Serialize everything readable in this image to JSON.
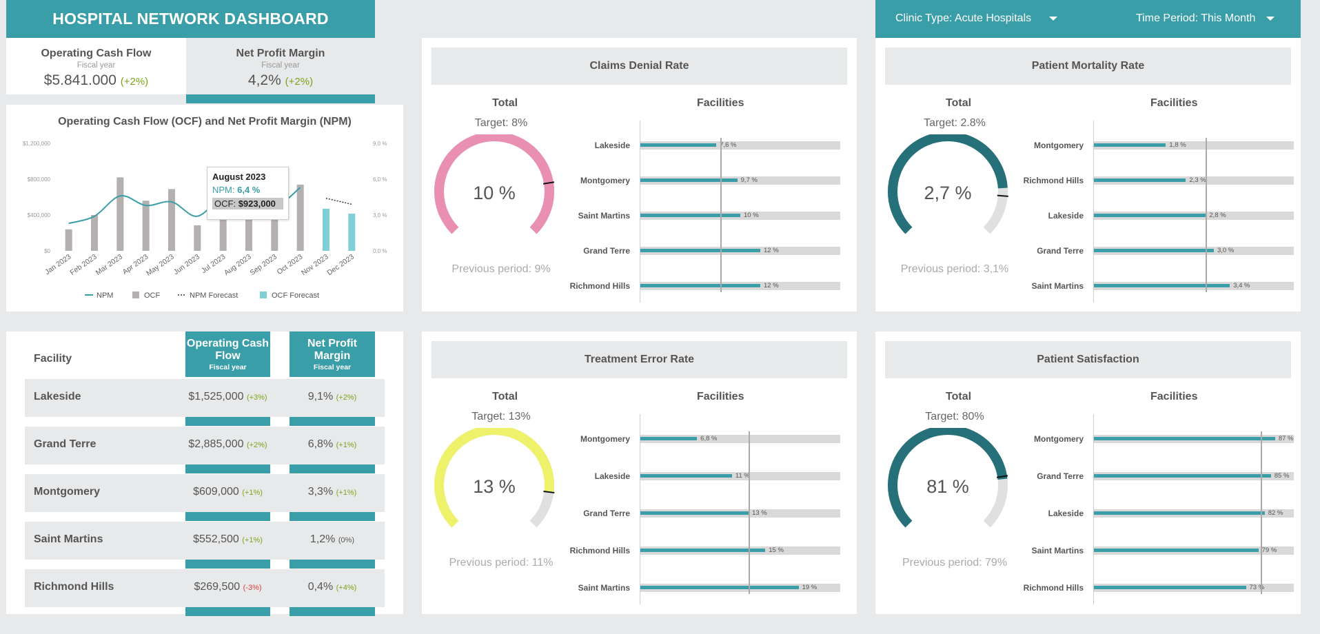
{
  "header": {
    "title": "HOSPITAL NETWORK DASHBOARD"
  },
  "filters": [
    {
      "label": "Clinic Type: Acute Hospitals"
    },
    {
      "label": "Time Period: This Month"
    }
  ],
  "kpis": [
    {
      "title": "Operating Cash Flow",
      "subtitle": "Fiscal year",
      "value": "$5.841.000",
      "change": "(+2%)"
    },
    {
      "title": "Net Profit Margin",
      "subtitle": "Fiscal year",
      "value": "4,2%",
      "change": "(+2%)"
    }
  ],
  "chart_panel": {
    "tooltip": {
      "title": "August 2023",
      "npm_label": "NPM:",
      "npm_value": "6,4 %",
      "ocf_label": "OCF:",
      "ocf_value": "$923,000"
    }
  },
  "chart_data": {
    "type": "bar",
    "title": "Operating Cash Flow (OCF) and Net Profit Margin (NPM)",
    "categories": [
      "Jan 2023",
      "Feb 2023",
      "Mar 2023",
      "Apr 2023",
      "May 2023",
      "Jun 2023",
      "Jul 2023",
      "Aug 2023",
      "Sep 2023",
      "Oct 2023",
      "Nov 2023",
      "Dec 2023"
    ],
    "y_left_ticks": [
      "$1,200,000",
      "$800,000",
      "$400,000",
      "$0"
    ],
    "y_right_ticks": [
      "9,0 %",
      "6,0 %",
      "3,0 %",
      "0,0 %"
    ],
    "ylim_left": [
      0,
      1200000
    ],
    "ylim_right": [
      0,
      9
    ],
    "series": [
      {
        "name": "OCF",
        "type": "bar",
        "color": "#b5b0b0",
        "values": [
          240000,
          400000,
          820000,
          560000,
          690000,
          285000,
          520000,
          923000,
          590000,
          740000,
          null,
          null
        ]
      },
      {
        "name": "OCF Forecast",
        "type": "bar",
        "color": "#7fcfd7",
        "values": [
          null,
          null,
          null,
          null,
          null,
          null,
          null,
          null,
          null,
          null,
          470000,
          415000
        ]
      },
      {
        "name": "NPM",
        "type": "line",
        "color": "#3a9ea9",
        "values": [
          2.3,
          2.9,
          4.6,
          3.8,
          4.1,
          2.9,
          4.8,
          6.4,
          3.9,
          5.3,
          null,
          null
        ]
      },
      {
        "name": "NPM Forecast",
        "type": "dashed",
        "color": "#333333",
        "values": [
          null,
          null,
          null,
          null,
          null,
          null,
          null,
          null,
          null,
          null,
          4.4,
          3.9
        ]
      }
    ],
    "legend": [
      "NPM",
      "OCF",
      "NPM Forecast",
      "OCF Forecast"
    ]
  },
  "table": {
    "col_facility": "Facility",
    "col_ocf": "Operating Cash Flow",
    "col_ocf_sub": "Fiscal year",
    "col_npm": "Net Profit Margin",
    "col_npm_sub": "Fiscal year",
    "rows": [
      {
        "name": "Lakeside",
        "ocf": "$1,525,000",
        "ocf_chg": "(+3%)",
        "ocf_dir": "up",
        "npm": "9,1%",
        "npm_chg": "(+2%)",
        "npm_dir": "up"
      },
      {
        "name": "Grand Terre",
        "ocf": "$2,885,000",
        "ocf_chg": "(+2%)",
        "ocf_dir": "up",
        "npm": "6,8%",
        "npm_chg": "(+1%)",
        "npm_dir": "up"
      },
      {
        "name": "Montgomery",
        "ocf": "$609,000",
        "ocf_chg": "(+1%)",
        "ocf_dir": "up",
        "npm": "3,3%",
        "npm_chg": "(+1%)",
        "npm_dir": "up"
      },
      {
        "name": "Saint Martins",
        "ocf": "$552,500",
        "ocf_chg": "(+1%)",
        "ocf_dir": "up",
        "npm": "1,2%",
        "npm_chg": "(0%)",
        "npm_dir": "flat"
      },
      {
        "name": "Richmond Hills",
        "ocf": "$269,500",
        "ocf_chg": "(-3%)",
        "ocf_dir": "down",
        "npm": "0,4%",
        "npm_chg": "(+4%)",
        "npm_dir": "up"
      }
    ]
  },
  "metrics": [
    {
      "title": "Claims Denial Rate",
      "total_label": "Total",
      "facilities_label": "Facilities",
      "target": "Target: 8%",
      "value": "10 %",
      "previous": "Previous period: 9%",
      "gauge_color": "#e98fb2",
      "gauge_fraction": 1.0,
      "target_fraction": 0.8,
      "target_pct": 8,
      "max_pct": 20,
      "facilities": [
        {
          "name": "Lakeside",
          "pct": 7.6,
          "label": "7,6 %"
        },
        {
          "name": "Montgomery",
          "pct": 9.7,
          "label": "9,7 %"
        },
        {
          "name": "Saint Martins",
          "pct": 10,
          "label": "10 %"
        },
        {
          "name": "Grand Terre",
          "pct": 12,
          "label": "12 %"
        },
        {
          "name": "Richmond Hills",
          "pct": 12,
          "label": "12 %"
        }
      ]
    },
    {
      "title": "Patient Mortality Rate",
      "total_label": "Total",
      "facilities_label": "Facilities",
      "target": "Target: 2.8%",
      "value": "2,7 %",
      "previous": "Previous period: 3,1%",
      "gauge_color": "#26707a",
      "gauge_fraction": 0.82,
      "target_fraction": 0.85,
      "target_pct": 2.8,
      "max_pct": 5.0,
      "facilities": [
        {
          "name": "Montgomery",
          "pct": 1.8,
          "label": "1,8 %"
        },
        {
          "name": "Richmond Hills",
          "pct": 2.3,
          "label": "2,3 %"
        },
        {
          "name": "Lakeside",
          "pct": 2.8,
          "label": "2,8 %"
        },
        {
          "name": "Grand Terre",
          "pct": 3.0,
          "label": "3,0 %"
        },
        {
          "name": "Saint Martins",
          "pct": 3.4,
          "label": "3,4 %"
        }
      ]
    },
    {
      "title": "Treatment Error Rate",
      "total_label": "Total",
      "facilities_label": "Facilities",
      "target": "Target: 13%",
      "value": "13 %",
      "previous": "Previous period: 11%",
      "gauge_color": "#eef26b",
      "gauge_fraction": 0.86,
      "target_fraction": 0.86,
      "target_pct": 13,
      "max_pct": 24,
      "facilities": [
        {
          "name": "Montgomery",
          "pct": 6.8,
          "label": "6,8 %"
        },
        {
          "name": "Lakeside",
          "pct": 11,
          "label": "11 %"
        },
        {
          "name": "Grand Terre",
          "pct": 13,
          "label": "13 %"
        },
        {
          "name": "Richmond Hills",
          "pct": 15,
          "label": "15 %"
        },
        {
          "name": "Saint Martins",
          "pct": 19,
          "label": "19 %"
        }
      ]
    },
    {
      "title": "Patient Satisfaction",
      "total_label": "Total",
      "facilities_label": "Facilities",
      "target": "Target: 80%",
      "value": "81 %",
      "previous": "Previous period: 79%",
      "gauge_color": "#26707a",
      "gauge_fraction": 0.81,
      "target_fraction": 0.8,
      "target_pct": 80,
      "max_pct": 96,
      "facilities": [
        {
          "name": "Montgomery",
          "pct": 87,
          "label": "87 %"
        },
        {
          "name": "Grand Terre",
          "pct": 85,
          "label": "85 %"
        },
        {
          "name": "Lakeside",
          "pct": 82,
          "label": "82 %"
        },
        {
          "name": "Saint Martins",
          "pct": 79,
          "label": "79 %"
        },
        {
          "name": "Richmond Hills",
          "pct": 73,
          "label": "73 %"
        }
      ]
    }
  ]
}
